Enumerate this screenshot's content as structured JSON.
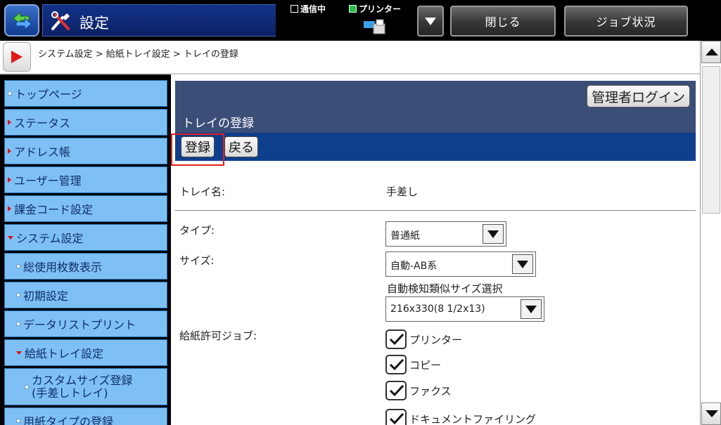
{
  "topbar": {
    "title": "設定",
    "status_comm": "通信中",
    "status_printer": "プリンター",
    "close_label": "閉じる",
    "job_status_label": "ジョブ状況"
  },
  "breadcrumb": {
    "text": "システム設定 > 給紙トレイ設定 > トレイの登録"
  },
  "sidebar": {
    "items": [
      {
        "label": "トップページ"
      },
      {
        "label": "ステータス"
      },
      {
        "label": "アドレス帳"
      },
      {
        "label": "ユーザー管理"
      },
      {
        "label": "課金コード設定"
      },
      {
        "label": "システム設定"
      },
      {
        "label": "総使用枚数表示"
      },
      {
        "label": "初期設定"
      },
      {
        "label": "データリストプリント"
      },
      {
        "label": "給紙トレイ設定"
      },
      {
        "label_line1": "カスタムサイズ登録",
        "label_line2": "(手差しトレイ)"
      },
      {
        "label": "用紙タイプの登録"
      }
    ]
  },
  "main": {
    "admin_login": "管理者ログイン",
    "page_title": "トレイの登録",
    "register_label": "登録",
    "back_label": "戻る",
    "tray_name_label": "トレイ名:",
    "tray_name_value": "手差し",
    "type_label": "タイプ:",
    "type_value": "普通紙",
    "size_label": "サイズ:",
    "size_value": "自動-AB系",
    "auto_detect_label": "自動検知類似サイズ選択",
    "auto_detect_value": "216x330(8 1/2x13)",
    "allowed_jobs_label": "給紙許可ジョブ:",
    "jobs": [
      {
        "label": "プリンター",
        "checked": true
      },
      {
        "label": "コピー",
        "checked": true
      },
      {
        "label": "ファクス",
        "checked": true
      },
      {
        "label": "ドキュメントファイリング",
        "checked": true
      }
    ]
  }
}
